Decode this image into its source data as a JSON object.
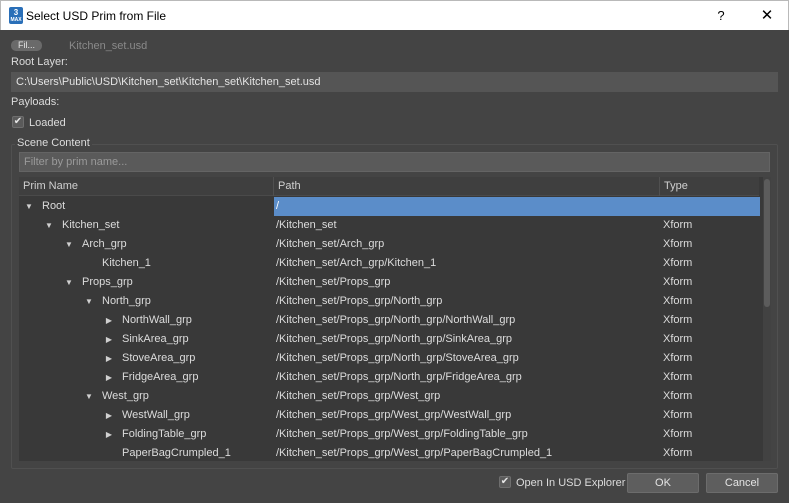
{
  "window": {
    "title": "Select USD Prim from File",
    "icon_text": "3",
    "icon_label": "MAX",
    "help_label": "?",
    "close_label": "✕"
  },
  "file": {
    "button_label": "Fil...",
    "name": "Kitchen_set.usd"
  },
  "root_layer": {
    "label": "Root Layer:",
    "value": "C:\\Users\\Public\\USD\\Kitchen_set\\Kitchen_set\\Kitchen_set.usd"
  },
  "payloads": {
    "label": "Payloads:",
    "loaded_label": "Loaded",
    "loaded_checked": true
  },
  "scene_content": {
    "title": "Scene Content",
    "filter_placeholder": "Filter by prim name...",
    "columns": [
      "Prim Name",
      "Path",
      "Type"
    ],
    "rows": [
      {
        "name": "Root",
        "path": "/",
        "type": "",
        "depth": 0,
        "arrow": "expanded",
        "selected": true
      },
      {
        "name": "Kitchen_set",
        "path": "/Kitchen_set",
        "type": "Xform",
        "depth": 1,
        "arrow": "expanded",
        "selected": false
      },
      {
        "name": "Arch_grp",
        "path": "/Kitchen_set/Arch_grp",
        "type": "Xform",
        "depth": 2,
        "arrow": "expanded",
        "selected": false
      },
      {
        "name": "Kitchen_1",
        "path": "/Kitchen_set/Arch_grp/Kitchen_1",
        "type": "Xform",
        "depth": 3,
        "arrow": "none",
        "selected": false
      },
      {
        "name": "Props_grp",
        "path": "/Kitchen_set/Props_grp",
        "type": "Xform",
        "depth": 2,
        "arrow": "expanded",
        "selected": false
      },
      {
        "name": "North_grp",
        "path": "/Kitchen_set/Props_grp/North_grp",
        "type": "Xform",
        "depth": 3,
        "arrow": "expanded",
        "selected": false
      },
      {
        "name": "NorthWall_grp",
        "path": "/Kitchen_set/Props_grp/North_grp/NorthWall_grp",
        "type": "Xform",
        "depth": 4,
        "arrow": "collapsed",
        "selected": false
      },
      {
        "name": "SinkArea_grp",
        "path": "/Kitchen_set/Props_grp/North_grp/SinkArea_grp",
        "type": "Xform",
        "depth": 4,
        "arrow": "collapsed",
        "selected": false
      },
      {
        "name": "StoveArea_grp",
        "path": "/Kitchen_set/Props_grp/North_grp/StoveArea_grp",
        "type": "Xform",
        "depth": 4,
        "arrow": "collapsed",
        "selected": false
      },
      {
        "name": "FridgeArea_grp",
        "path": "/Kitchen_set/Props_grp/North_grp/FridgeArea_grp",
        "type": "Xform",
        "depth": 4,
        "arrow": "collapsed",
        "selected": false
      },
      {
        "name": "West_grp",
        "path": "/Kitchen_set/Props_grp/West_grp",
        "type": "Xform",
        "depth": 3,
        "arrow": "expanded",
        "selected": false
      },
      {
        "name": "WestWall_grp",
        "path": "/Kitchen_set/Props_grp/West_grp/WestWall_grp",
        "type": "Xform",
        "depth": 4,
        "arrow": "collapsed",
        "selected": false
      },
      {
        "name": "FoldingTable_grp",
        "path": "/Kitchen_set/Props_grp/West_grp/FoldingTable_grp",
        "type": "Xform",
        "depth": 4,
        "arrow": "collapsed",
        "selected": false
      },
      {
        "name": "PaperBagCrumpled_1",
        "path": "/Kitchen_set/Props_grp/West_grp/PaperBagCrumpled_1",
        "type": "Xform",
        "depth": 4,
        "arrow": "none",
        "selected": false
      }
    ]
  },
  "footer": {
    "open_in_explorer_label": "Open In USD Explorer",
    "open_in_explorer_checked": true,
    "ok_label": "OK",
    "cancel_label": "Cancel"
  },
  "icons": {
    "expanded": "triangle-down-icon",
    "collapsed": "triangle-right-icon",
    "checkbox": "checkmark-icon"
  },
  "colors": {
    "background": "#444444",
    "selection": "#5b8dc9",
    "titlebar": "#ffffff"
  }
}
